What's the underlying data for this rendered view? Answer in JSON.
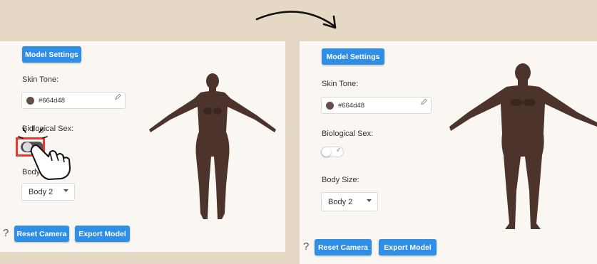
{
  "colors": {
    "accent": "#2f8fe6",
    "skin": "#664d48",
    "highlight": "#e53935",
    "page_bg": "#e5d8c5",
    "panel_bg": "#faf6f1"
  },
  "before": {
    "model_settings_label": "Model Settings",
    "skin_tone_label": "Skin Tone:",
    "skin_tone_value": "#664d48",
    "biological_sex_label": "Biological Sex:",
    "body_size_label": "Body Size:",
    "body_size_value": "Body 2",
    "reset_camera_label": "Reset Camera",
    "export_model_label": "Export Model",
    "help_symbol": "?"
  },
  "after": {
    "model_settings_label": "Model Settings",
    "skin_tone_label": "Skin Tone:",
    "skin_tone_value": "#664d48",
    "biological_sex_label": "Biological Sex:",
    "sex_symbol": "♂",
    "body_size_label": "Body Size:",
    "body_size_value": "Body 2",
    "reset_camera_label": "Reset Camera",
    "export_model_label": "Export Model",
    "help_symbol": "?"
  }
}
